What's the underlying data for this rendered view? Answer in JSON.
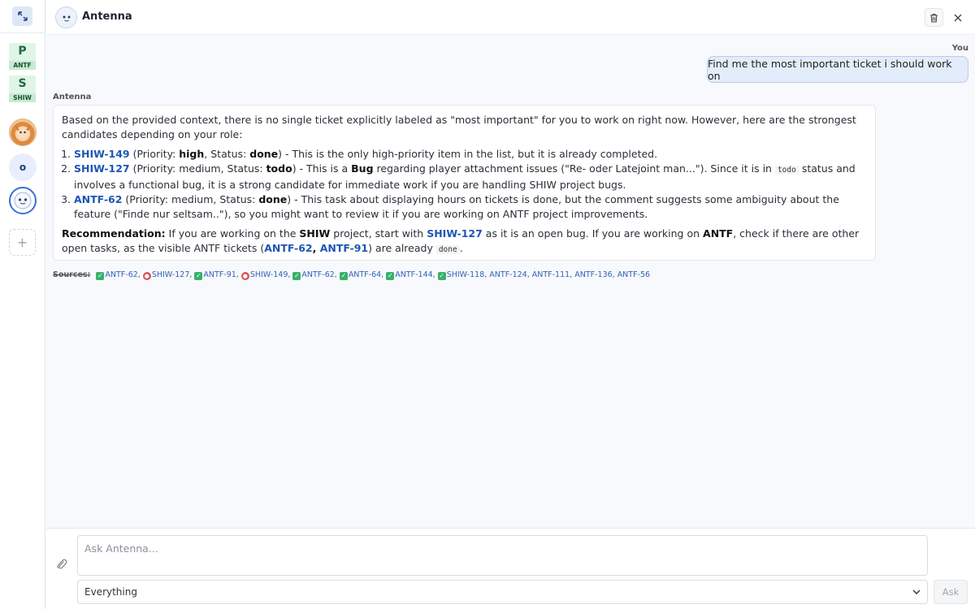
{
  "app": {
    "title": "Antenna"
  },
  "rail": {
    "projects": [
      {
        "letter": "P",
        "key": "ANTF",
        "color": "#dff5e6"
      },
      {
        "letter": "S",
        "key": "SHIW",
        "color": "#dff5e6"
      }
    ],
    "avatar_o_initial": "o",
    "add_label": "+"
  },
  "chat": {
    "user_label": "You",
    "user_message": "Find me the most important ticket i should work on",
    "bot_label": "Antenna",
    "bot": {
      "intro": "Based on the provided context, there is no single ticket explicitly labeled as \"most important\" for you to work on right now. However, here are the strongest candidates depending on your role:",
      "items": [
        {
          "ticket": "SHIW-149",
          "p_prefix": " (Priority: ",
          "priority": "high",
          "s_prefix": ", Status: ",
          "status": "done",
          "rest": ") - This is the only high-priority item in the list, but it is already completed."
        },
        {
          "ticket": "SHIW-127",
          "p_prefix": " (Priority: medium, Status: ",
          "status": "todo",
          "mid": ") - This is a ",
          "bug": "Bug",
          "rest1": " regarding player attachment issues (\"Re- oder Latejoint man...\"). Since it is in ",
          "code": "todo",
          "rest2": " status and involves a functional bug, it is a strong candidate for immediate work if you are handling SHIW project bugs."
        },
        {
          "ticket": "ANTF-62",
          "p_prefix": " (Priority: medium, Status: ",
          "status": "done",
          "rest": ") - This task about displaying hours on tickets is done, but the comment suggests some ambiguity about the feature (\"Finde nur seltsam..\"), so you might want to review it if you are working on ANTF project improvements."
        }
      ],
      "rec": {
        "label": "Recommendation:",
        "t1": " If you are working on the ",
        "proj1": "SHIW",
        "t2": " project, start with ",
        "ticket1": "SHIW-127",
        "t3": " as it is an open bug. If you are working on ",
        "proj2": "ANTF",
        "t4": ", check if there are other open tasks, as the visible ANTF tickets (",
        "ticket2": "ANTF-62",
        "sep": ", ",
        "ticket3": "ANTF-91",
        "t5": ") are already ",
        "code": "done",
        "t6": "."
      }
    },
    "sources_label": "Sources:",
    "sources": [
      {
        "kind": "task",
        "id": "ANTF-62"
      },
      {
        "kind": "bug",
        "id": "SHIW-127"
      },
      {
        "kind": "task",
        "id": "ANTF-91"
      },
      {
        "kind": "bug",
        "id": "SHIW-149"
      },
      {
        "kind": "task",
        "id": "ANTF-62"
      },
      {
        "kind": "task",
        "id": "ANTF-64"
      },
      {
        "kind": "task",
        "id": "ANTF-144"
      },
      {
        "kind": "task",
        "id": "SHIW-118"
      },
      {
        "kind": "none",
        "id": "ANTF-124"
      },
      {
        "kind": "none",
        "id": "ANTF-111"
      },
      {
        "kind": "none",
        "id": "ANTF-136"
      },
      {
        "kind": "none",
        "id": "ANTF-56"
      }
    ]
  },
  "composer": {
    "placeholder": "Ask Antenna...",
    "scope_value": "Everything",
    "ask_label": "Ask"
  },
  "icons": {
    "expand": "expand-icon",
    "trash": "trash-icon",
    "close": "close-icon",
    "attach": "paperclip-icon",
    "chevron": "chevron-down-icon"
  },
  "colors": {
    "accent": "#1d56b3",
    "user_bubble": "#e3ecfa",
    "task_check": "#3ab06a",
    "bug": "#d9534f"
  }
}
